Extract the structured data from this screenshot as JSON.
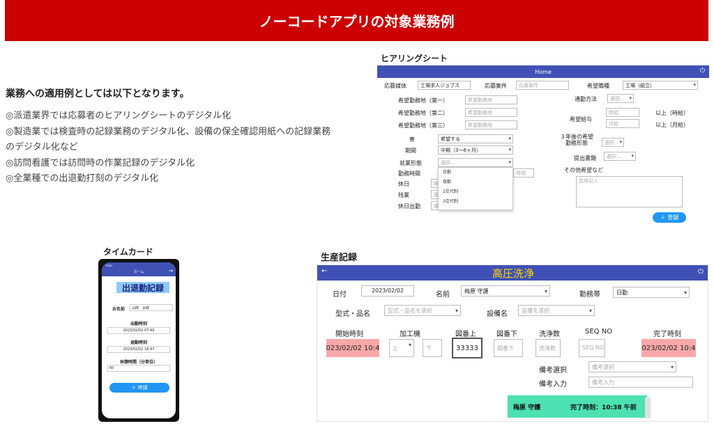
{
  "banner": {
    "title": "ノーコードアプリの対象業務例"
  },
  "intro": {
    "heading": "業務への適用例としては以下となります。",
    "bullets": [
      "◎派遣業界では応募者のヒアリングシートのデジタル化",
      "◎製造業では検査時の記録業務のデジタル化、設備の保全確認用紙への記録業務のデジタル化など",
      "◎訪問看護では訪問時の作業記録のデジタル化",
      "◎全業種での出退勤打刻のデジタル化"
    ]
  },
  "hearing_sheet": {
    "caption": "ヒアリングシート",
    "bar_title": "Home",
    "labels": {
      "media": "応募媒体",
      "case": "応募案件",
      "job": "希望職種",
      "area1": "希望勤務地（第一）",
      "area2": "希望勤務地（第二）",
      "area3": "希望勤務地（第三）",
      "commute": "通勤方法",
      "salary": "希望給与",
      "dorm": "寮",
      "period": "期間",
      "emp_type": "就業形態",
      "future_type": "３年後の希望\n勤務形態",
      "docs": "提出書類",
      "work_time": "勤務時間",
      "holiday": "休日",
      "overtime": "残業",
      "holiday_work": "休日出勤",
      "other": "その他希望など",
      "above_hour": "以上（時給）",
      "above_month": "以上（月給）"
    },
    "values": {
      "media": "工場求人ジョブス",
      "case_ph": "応募案件",
      "job": "工場（組立）",
      "area_ph": "希望勤務地",
      "commute_ph": "選択...",
      "hourly_ph": "時給",
      "monthly_ph": "月給",
      "dorm": "希望する",
      "period": "中期（3～6ヶ月）",
      "emp_type_ph": "選択...",
      "future_ph": "選択...",
      "docs_ph": "選択...",
      "other_ph": "具体記入",
      "work_time_ph": "時間",
      "holiday_ph": "曜",
      "overtime_ph": "選択",
      "holiday_work_ph": "選択"
    },
    "dropdown_options": [
      "日勤",
      "夜勤",
      "2交代制",
      "3交代制"
    ],
    "submit_label": "＋ 登録"
  },
  "timecard": {
    "caption": "タイムカード",
    "app_title": "出退勤記録",
    "status_left": "Gazi",
    "status_center": "ホーム",
    "name_label": "お名前",
    "name_value": "山田　太郎",
    "clock_in_label": "出勤時刻",
    "clock_in_value": "2023/02/02 07:40",
    "clock_out_label": "退勤時刻",
    "clock_out_value": "2023/02/02 18:47",
    "break_label": "休憩時間（分単位）",
    "break_value": "60",
    "submit_label": "＋ 申請"
  },
  "production": {
    "caption": "生産記録",
    "title": "高圧洗浄",
    "labels": {
      "date": "日付",
      "name": "名前",
      "shift": "勤務帯",
      "model": "型式・品名",
      "equip": "設備名",
      "start": "開始時刻",
      "machine": "加工機",
      "fig_up": "図番上",
      "fig_down": "図番下",
      "wash_count": "洗浄数",
      "seq": "SEQ NO",
      "end": "完了時刻",
      "remark_select": "備考選択",
      "remark_input": "備考入力"
    },
    "values": {
      "date": "2023/02/02",
      "name": "梅原 守護",
      "shift": "日勤",
      "model_ph": "型式・品名を選択",
      "equip_ph": "設備を選択",
      "start": "2023/02/02 10:45",
      "machine": "上",
      "machine2_ph": "下",
      "fig_up": "33333",
      "fig_down_ph": "図番下",
      "wash_ph": "洗浄数",
      "seq_ph": "SEQ NO",
      "end": "2023/02/02 10:45",
      "remark_select_ph": "備考選択",
      "remark_input_ph": "備考入力"
    },
    "card": {
      "name": "梅原 守護",
      "done": "完了時刻：10:38 午前"
    }
  },
  "colors": {
    "banner": "#cc0000",
    "appbar": "#3f51b5",
    "accent": "#2196f3",
    "time_highlight": "#f8a8a8",
    "card": "#4de0b0"
  }
}
